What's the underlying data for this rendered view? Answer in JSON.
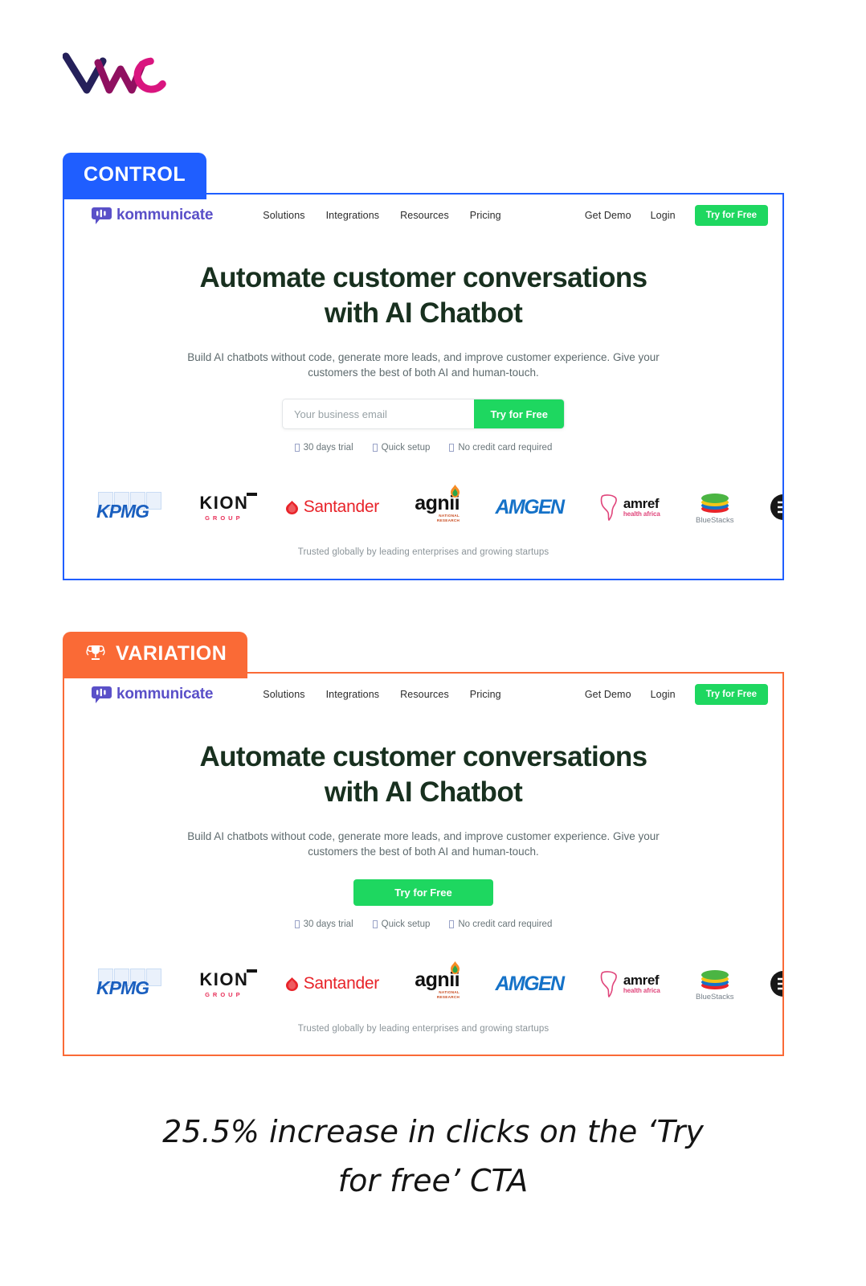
{
  "brand": {
    "logo_name": "vwo-logo",
    "logo_text": "VWO",
    "colors": {
      "navy": "#1f1a4f",
      "magenta": "#b01065",
      "pink": "#e0218a"
    }
  },
  "control": {
    "badge_label": "CONTROL",
    "badge_color": "#1f5eff",
    "border_color": "#1f5eff"
  },
  "variation": {
    "badge_label": "VARIATION",
    "badge_icon": "trophy-icon",
    "badge_color": "#fa6a36",
    "border_color": "#fa6a36"
  },
  "site": {
    "logo_text": "kommunicate",
    "logo_icon": "chat-bubble-icon",
    "nav_links": [
      "Solutions",
      "Integrations",
      "Resources",
      "Pricing"
    ],
    "nav_right": [
      "Get Demo",
      "Login"
    ],
    "nav_cta": "Try for Free",
    "hero_title_line1": "Automate customer conversations",
    "hero_title_line2": "with AI Chatbot",
    "hero_sub": "Build AI chatbots without code, generate more leads, and improve customer experience. Give your customers the best of both AI and human-touch.",
    "email_placeholder": "Your business email",
    "email_value": "",
    "form_cta": "Try for Free",
    "solo_cta": "Try for Free",
    "perks": [
      "30 days trial",
      "Quick setup",
      "No credit card required"
    ],
    "trust_line": "Trusted globally by leading enterprises and growing startups",
    "logos": [
      {
        "name": "kpmg-logo",
        "label": "KPMG"
      },
      {
        "name": "kion-group-logo",
        "label": "KION",
        "sub": "GROUP"
      },
      {
        "name": "santander-logo",
        "label": "Santander"
      },
      {
        "name": "agnii-logo",
        "label": "agnii",
        "sub": "NATIONAL\nRESEARCH"
      },
      {
        "name": "amgen-logo",
        "label": "AMGEN"
      },
      {
        "name": "amref-logo",
        "label": "amref",
        "sub": "health africa"
      },
      {
        "name": "bluestacks-logo",
        "label": "BlueStacks"
      },
      {
        "name": "circle-badge-logo",
        "label": ""
      }
    ]
  },
  "caption": {
    "line1": "25.5% increase in clicks on the ‘Try",
    "line2": "for free’ CTA"
  }
}
